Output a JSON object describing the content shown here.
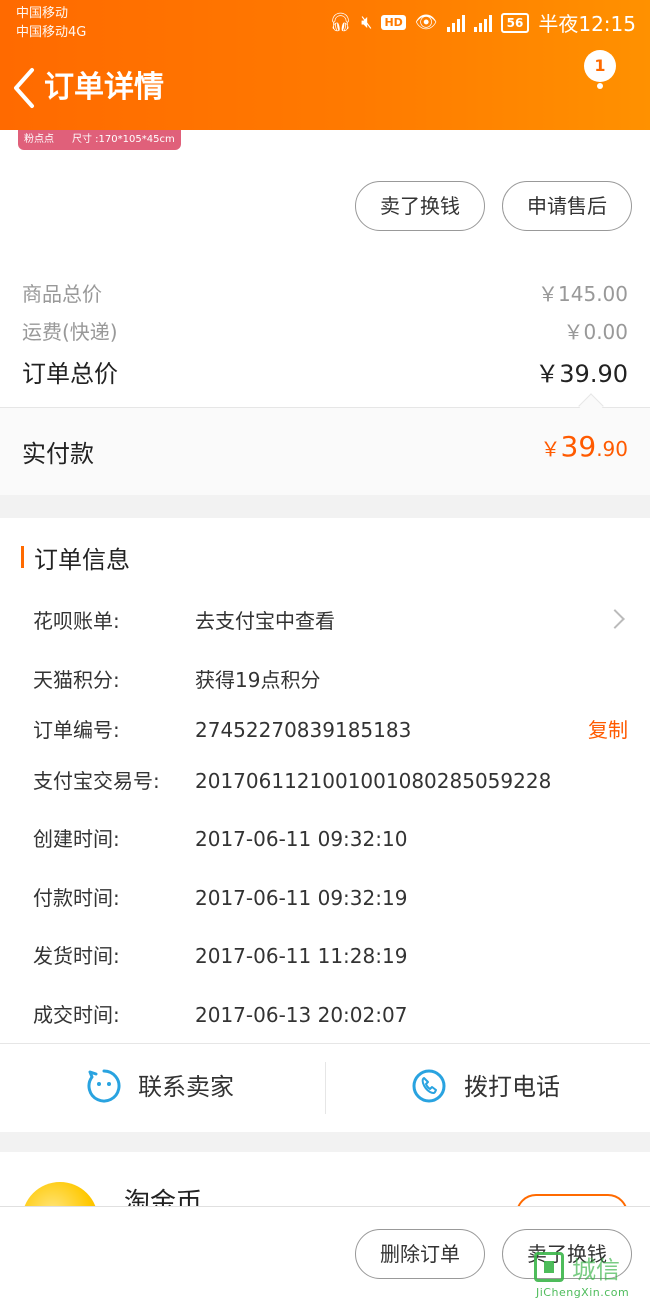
{
  "status_bar": {
    "carrier1": "中国移动",
    "carrier2": "中国移动4G",
    "hd": "HD",
    "battery": "56",
    "time": "半夜12:15"
  },
  "nav": {
    "title": "订单详情",
    "badge": "1"
  },
  "product_thumb": {
    "tag": "粉点点",
    "size": "尺寸 :170*105*45cm"
  },
  "actions": {
    "sell_label": "卖了换钱",
    "after_sale_label": "申请售后"
  },
  "pricing": {
    "goods_total_label": "商品总价",
    "goods_total_value": "￥145.00",
    "shipping_label": "运费(快递)",
    "shipping_value": "￥0.00",
    "order_total_label": "订单总价",
    "order_total_value": "￥39.90",
    "paid_label": "实付款",
    "paid_yen": "￥",
    "paid_int": "39",
    "paid_dec": ".90"
  },
  "order_info": {
    "title": "订单信息",
    "rows": [
      {
        "label": "花呗账单:",
        "value": "去支付宝中查看"
      },
      {
        "label": "天猫积分:",
        "value": "获得19点积分"
      },
      {
        "label": "订单编号:",
        "value": "27452270839185183",
        "action": "复制"
      },
      {
        "label": "支付宝交易号:",
        "value": "2017061121001001080285059228"
      },
      {
        "label": "创建时间:",
        "value": "2017-06-11 09:32:10"
      },
      {
        "label": "付款时间:",
        "value": "2017-06-11 09:32:19"
      },
      {
        "label": "发货时间:",
        "value": "2017-06-11 11:28:19"
      },
      {
        "label": "成交时间:",
        "value": "2017-06-13 20:02:07"
      }
    ]
  },
  "contact": {
    "seller_label": "联系卖家",
    "phone_label": "拨打电话"
  },
  "taojinbi": {
    "title": "淘金币"
  },
  "bottom_bar": {
    "delete_label": "删除订单",
    "sell_label": "卖了换钱"
  },
  "watermark": {
    "cn": "城信",
    "en": "JiChengXin.com"
  },
  "colors": {
    "accent": "#ff6a00",
    "price_accent": "#ff5a00",
    "watermark": "#3bb54a"
  }
}
